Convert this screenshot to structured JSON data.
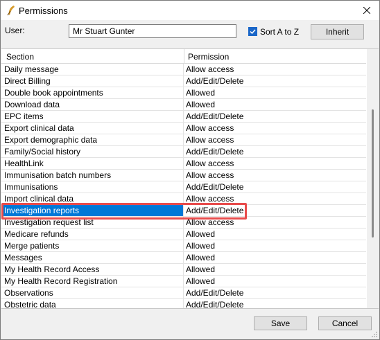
{
  "window": {
    "title": "Permissions",
    "icons": {
      "app": "feather-icon",
      "close": "close-icon",
      "checkbox": "checkmark-icon",
      "resize": "resize-grip-icon"
    }
  },
  "user": {
    "label": "User:",
    "value": "Mr Stuart Gunter"
  },
  "options": {
    "sort_label": "Sort A to Z",
    "sort_checked": true,
    "inherit_label": "Inherit"
  },
  "grid": {
    "columns": [
      "Section",
      "Permission"
    ],
    "selected_index": 12,
    "rows": [
      {
        "section": "Daily message",
        "permission": "Allow access"
      },
      {
        "section": "Direct Billing",
        "permission": "Add/Edit/Delete"
      },
      {
        "section": "Double book appointments",
        "permission": "Allowed"
      },
      {
        "section": "Download data",
        "permission": "Allowed"
      },
      {
        "section": "EPC items",
        "permission": "Add/Edit/Delete"
      },
      {
        "section": "Export clinical data",
        "permission": "Allow access"
      },
      {
        "section": "Export demographic data",
        "permission": "Allow access"
      },
      {
        "section": "Family/Social history",
        "permission": "Add/Edit/Delete"
      },
      {
        "section": "HealthLink",
        "permission": "Allow access"
      },
      {
        "section": "Immunisation batch numbers",
        "permission": "Allow access"
      },
      {
        "section": "Immunisations",
        "permission": "Add/Edit/Delete"
      },
      {
        "section": "Import clinical data",
        "permission": "Allow access"
      },
      {
        "section": "Investigation reports",
        "permission": "Add/Edit/Delete"
      },
      {
        "section": "Investigation request list",
        "permission": "Allow access"
      },
      {
        "section": "Medicare refunds",
        "permission": "Allowed"
      },
      {
        "section": "Merge patients",
        "permission": "Allowed"
      },
      {
        "section": "Messages",
        "permission": "Allowed"
      },
      {
        "section": "My Health Record Access",
        "permission": "Allowed"
      },
      {
        "section": "My Health Record Registration",
        "permission": "Allowed"
      },
      {
        "section": "Observations",
        "permission": "Add/Edit/Delete"
      },
      {
        "section": "Obstetric data",
        "permission": "Add/Edit/Delete"
      }
    ]
  },
  "footer": {
    "save_label": "Save",
    "cancel_label": "Cancel"
  },
  "colors": {
    "selection": "#0078d7",
    "highlight": "#e84c4c",
    "checkbox": "#1a66c8"
  }
}
